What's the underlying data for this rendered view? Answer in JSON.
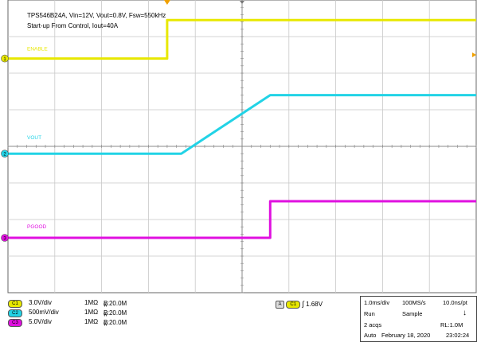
{
  "title": {
    "line1": "TPS546B24A, Vin=12V, Vout=0.8V, Fsw=550kHz",
    "line2": "Start-up From Control, Iout=40A"
  },
  "colors": {
    "ch1": "#e8e800",
    "ch2": "#22d3e6",
    "ch3": "#e010e0",
    "grid": "#c8c8c8",
    "trigger": "#f0a000"
  },
  "chart_data": {
    "type": "line",
    "x_unit": "ms",
    "xlim": [
      -5,
      5
    ],
    "grid": true,
    "series": [
      {
        "name": "ENABLE",
        "channel": "1",
        "scale_v_per_div": 3.0,
        "offset_div": 2.4,
        "x": [
          -5.0,
          -1.6,
          -1.6,
          5.0
        ],
        "y_div": [
          0.0,
          0.0,
          1.05,
          1.05
        ]
      },
      {
        "name": "VOUT",
        "channel": "2",
        "scale_v_per_div": 0.5,
        "offset_div": -0.2,
        "x": [
          -5.0,
          -1.3,
          0.6,
          5.0
        ],
        "y_div": [
          0.0,
          0.0,
          1.6,
          1.6
        ]
      },
      {
        "name": "PGOOD",
        "channel": "3",
        "scale_v_per_div": 5.0,
        "offset_div": -2.5,
        "x": [
          -5.0,
          0.6,
          0.6,
          5.0
        ],
        "y_div": [
          0.0,
          0.0,
          1.0,
          1.0
        ]
      }
    ]
  },
  "channels": [
    {
      "id": "1",
      "badge": "C1",
      "scale": "3.0V/div",
      "impedance": "1MΩ",
      "bw": "B",
      "bw_sub": "W",
      "bw_val": ":20.0M"
    },
    {
      "id": "2",
      "badge": "C2",
      "scale": "500mV/div",
      "impedance": "1MΩ",
      "bw": "B",
      "bw_sub": "W",
      "bw_val": ":20.0M"
    },
    {
      "id": "3",
      "badge": "C3",
      "scale": "5.0V/div",
      "impedance": "1MΩ",
      "bw": "B",
      "bw_sub": "W",
      "bw_val": ":20.0M"
    }
  ],
  "trigger": {
    "mode_icon": "A",
    "source": "C1",
    "slope": "∫",
    "level": "1.68V"
  },
  "acquisition": {
    "timebase": "1.0ms/div",
    "sample_rate": "100MS/s",
    "resolution": "10.0ns/pt",
    "state": "Run",
    "mode": "Sample",
    "acqs": "2 acqs",
    "record_length": "RL:1.0M",
    "trigger_mode": "Auto",
    "date": "February 18, 2020",
    "time": "23:02:24"
  }
}
